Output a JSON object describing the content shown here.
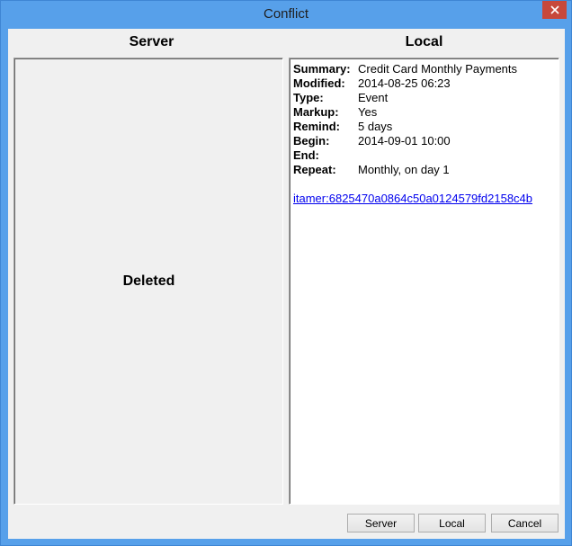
{
  "window": {
    "title": "Conflict",
    "close_label": "close"
  },
  "server": {
    "header": "Server",
    "status": "Deleted"
  },
  "local": {
    "header": "Local",
    "fields": [
      {
        "label": "Summary:",
        "value": "Credit Card Monthly Payments"
      },
      {
        "label": "Modified:",
        "value": "2014-08-25 06:23"
      },
      {
        "label": "Type:",
        "value": "Event"
      },
      {
        "label": "Markup:",
        "value": "Yes"
      },
      {
        "label": "Remind:",
        "value": "5 days"
      },
      {
        "label": "Begin:",
        "value": "2014-09-01 10:00"
      },
      {
        "label": "End:",
        "value": ""
      },
      {
        "label": "Repeat:",
        "value": "Monthly, on day 1"
      }
    ],
    "uid_link": "itamer:6825470a0864c50a0124579fd2158c4b"
  },
  "buttons": {
    "server": "Server",
    "local": "Local",
    "cancel": "Cancel"
  },
  "colors": {
    "frame": "#57a0ea",
    "close_button": "#c7483b",
    "dialog_background": "#f0f0f0",
    "link": "#0000ee"
  }
}
